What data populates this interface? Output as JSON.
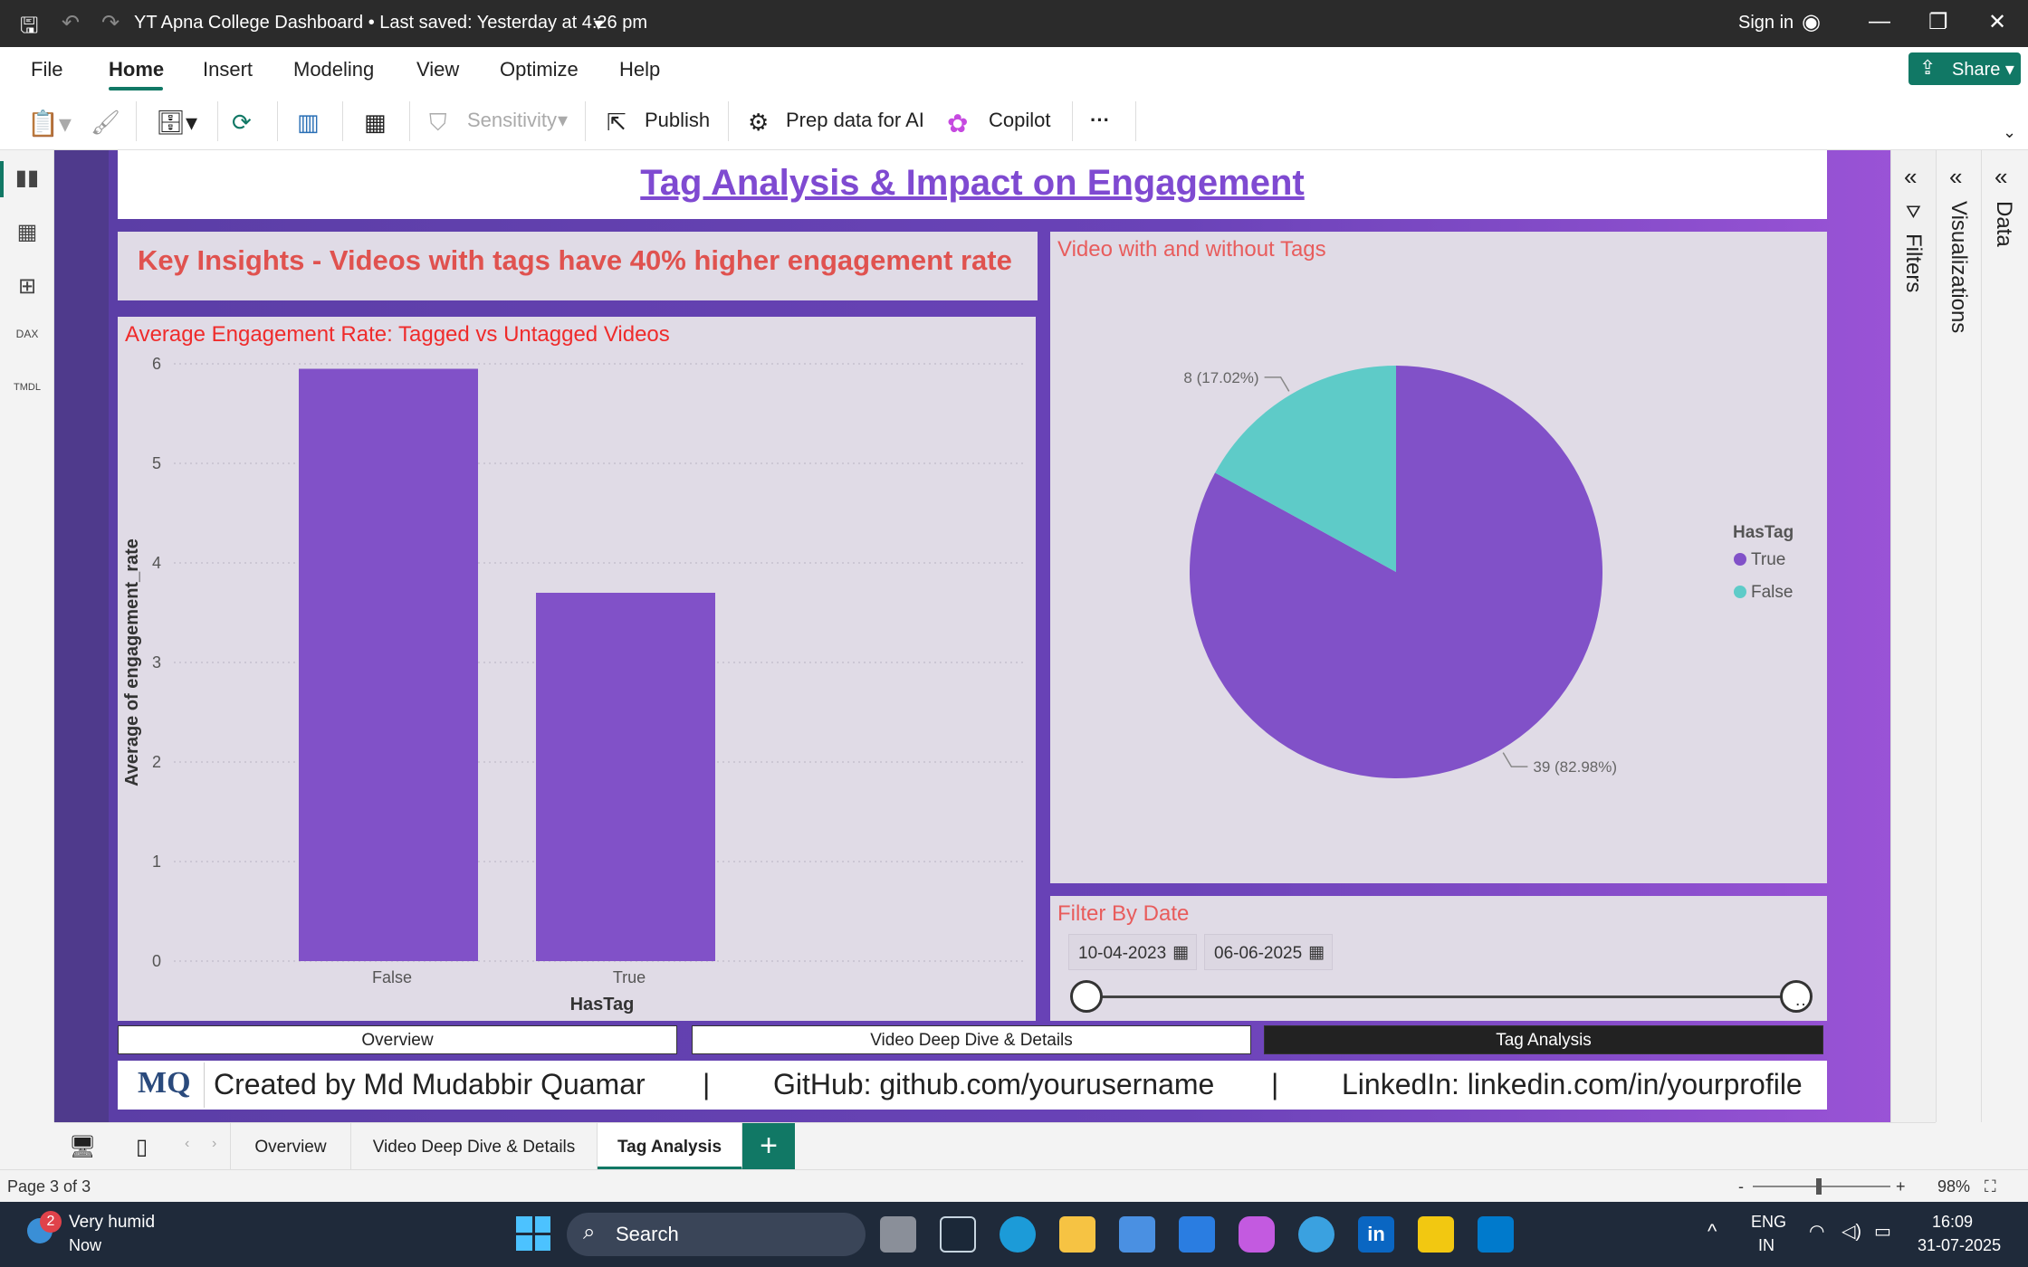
{
  "window": {
    "title": "YT Apna College Dashboard • Last saved: Yesterday at 4:26 pm",
    "sign_in": "Sign in"
  },
  "menu": {
    "items": [
      "File",
      "Home",
      "Insert",
      "Modeling",
      "View",
      "Optimize",
      "Help"
    ],
    "active": "Home",
    "share": "Share"
  },
  "ribbon": {
    "sensitivity": "Sensitivity",
    "publish": "Publish",
    "prep": "Prep data for AI",
    "copilot": "Copilot",
    "more": "···"
  },
  "report": {
    "title": "Tag Analysis & Impact on Engagement",
    "insight": "Key Insights - Videos with tags have 40% higher engagement rate",
    "bar_title": "Average Engagement Rate: Tagged vs Untagged Videos",
    "pie_title": "Video with and without Tags",
    "filter_title": "Filter By Date",
    "date_start": "10-04-2023",
    "date_end": "06-06-2025",
    "page_tabs": [
      "Overview",
      "Video Deep Dive & Details",
      "Tag Analysis"
    ],
    "footer": {
      "created": "Created by Md Mudabbir Quamar",
      "github": "GitHub: github.com/yourusername",
      "linkedin": "LinkedIn: linkedin.com/in/yourprofile",
      "sep": "|",
      "logo": "MQ"
    }
  },
  "chart_data": [
    {
      "type": "bar",
      "title": "Average Engagement Rate: Tagged vs Untagged Videos",
      "categories": [
        "False",
        "True"
      ],
      "values": [
        5.95,
        3.7
      ],
      "xlabel": "HasTag",
      "ylabel": "Average of engagement_rate",
      "ylim": [
        0,
        6
      ],
      "yticks": [
        "0",
        "1",
        "2",
        "3",
        "4",
        "5",
        "6"
      ],
      "grid": true,
      "color": "#8151c8"
    },
    {
      "type": "pie",
      "title": "Video with and without Tags",
      "legend_title": "HasTag",
      "legend_position": "right",
      "slices": [
        {
          "name": "True",
          "value": 39,
          "label": "39 (82.98%)",
          "color": "#8151c8"
        },
        {
          "name": "False",
          "value": 8,
          "label": "8 (17.02%)",
          "color": "#5ecbc8"
        }
      ]
    }
  ],
  "pagebar": {
    "tabs": [
      "Overview",
      "Video Deep Dive & Details",
      "Tag Analysis"
    ],
    "active": "Tag Analysis",
    "add": "+"
  },
  "panes": {
    "filters": "Filters",
    "visualizations": "Visualizations",
    "data": "Data"
  },
  "status": {
    "page": "Page 3 of 3",
    "zoom": "98%"
  },
  "taskbar": {
    "weather": "Very humid",
    "weather_sub": "Now",
    "badge": "2",
    "search": "Search",
    "lang1": "ENG",
    "lang2": "IN",
    "time": "16:09",
    "date": "31-07-2025"
  }
}
